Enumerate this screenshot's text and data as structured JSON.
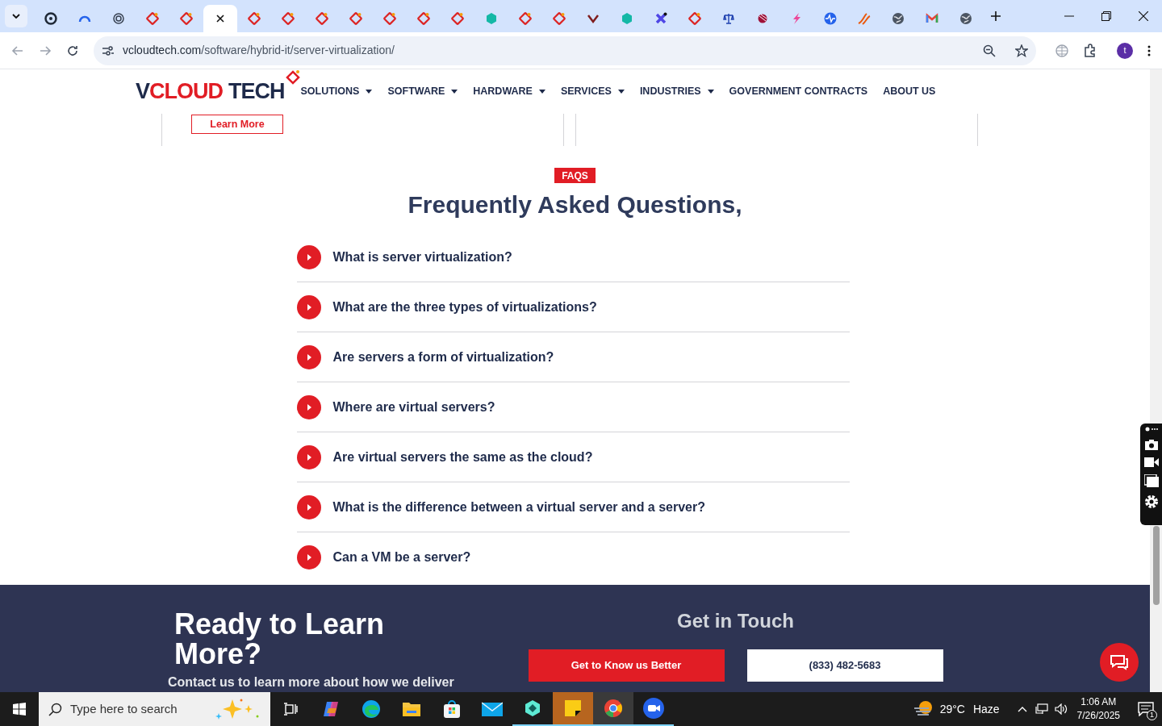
{
  "browser": {
    "tabs": [
      {
        "kind": "pokeball",
        "selected": false
      },
      {
        "kind": "gauge",
        "selected": false
      },
      {
        "kind": "knot",
        "selected": false
      },
      {
        "kind": "tag",
        "selected": false
      },
      {
        "kind": "tag",
        "selected": false
      },
      {
        "kind": "close",
        "selected": true
      },
      {
        "kind": "tag",
        "selected": false
      },
      {
        "kind": "tag",
        "selected": false
      },
      {
        "kind": "tag",
        "selected": false
      },
      {
        "kind": "tag",
        "selected": false
      },
      {
        "kind": "tag",
        "selected": false
      },
      {
        "kind": "tag",
        "selected": false
      },
      {
        "kind": "tag",
        "selected": false
      },
      {
        "kind": "hexagon",
        "selected": false
      },
      {
        "kind": "tag",
        "selected": false
      },
      {
        "kind": "tag",
        "selected": false
      },
      {
        "kind": "check",
        "selected": false
      },
      {
        "kind": "hexagon",
        "selected": false
      },
      {
        "kind": "cross",
        "selected": false
      },
      {
        "kind": "tag",
        "selected": false
      },
      {
        "kind": "scale",
        "selected": false
      },
      {
        "kind": "ball",
        "selected": false
      },
      {
        "kind": "bolt",
        "selected": false
      },
      {
        "kind": "pulse",
        "selected": false
      },
      {
        "kind": "swoosh",
        "selected": false
      },
      {
        "kind": "globe",
        "selected": false
      },
      {
        "kind": "mail",
        "selected": false
      },
      {
        "kind": "globe",
        "selected": false
      }
    ],
    "url_host": "vcloudtech.com",
    "url_path": "/software/hybrid-it/server-virtualization/",
    "profile_initial": "t"
  },
  "site": {
    "logo_first": "V",
    "logo_rest": "CLOUD",
    "logo_second": "TECH",
    "nav": [
      {
        "label": "SOLUTIONS",
        "has_menu": true
      },
      {
        "label": "SOFTWARE",
        "has_menu": true
      },
      {
        "label": "HARDWARE",
        "has_menu": true
      },
      {
        "label": "SERVICES",
        "has_menu": true
      },
      {
        "label": "INDUSTRIES",
        "has_menu": true
      },
      {
        "label": "GOVERNMENT CONTRACTS",
        "has_menu": false
      },
      {
        "label": "ABOUT US",
        "has_menu": false
      }
    ],
    "card_button": "Learn More",
    "faq": {
      "badge": "FAQS",
      "heading": "Frequently Asked Questions,",
      "questions": [
        {
          "text": "What is server virtualization?",
          "expanded": false
        },
        {
          "text": "What are the three types of virtualizations?",
          "expanded": false
        },
        {
          "text": "Are servers a form of virtualization?",
          "expanded": false
        },
        {
          "text": "Where are virtual servers?",
          "expanded": false
        },
        {
          "text": "Are virtual servers the same as the cloud?",
          "expanded": false
        },
        {
          "text": "What is the difference between a virtual server and a server?",
          "expanded": false
        },
        {
          "text": "Can a VM be a server?",
          "expanded": false
        }
      ]
    },
    "footer": {
      "heading": "Ready to Learn More?",
      "text": "Contact us to learn more about how we deliver",
      "contact_heading": "Get in Touch",
      "primary_button": "Get to Know us Better",
      "phone_button": "(833) 482-5683"
    }
  },
  "taskbar": {
    "search_placeholder": "Type here to search",
    "temperature": "29°C",
    "weather": "Haze",
    "time": "1:06 AM",
    "date": "7/26/2025",
    "notifications": "1"
  }
}
